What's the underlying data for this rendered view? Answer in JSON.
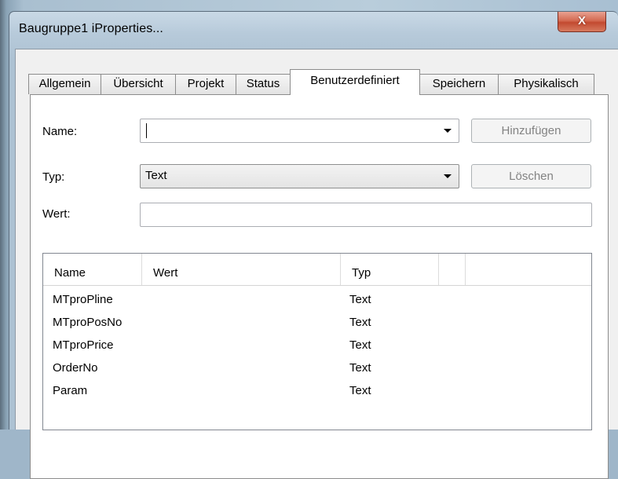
{
  "window": {
    "title": "Baugruppe1 iProperties...",
    "close_glyph": "X"
  },
  "tabs": [
    {
      "label": "Allgemein"
    },
    {
      "label": "Übersicht"
    },
    {
      "label": "Projekt"
    },
    {
      "label": "Status"
    },
    {
      "label": "Benutzerdefiniert",
      "active": true
    },
    {
      "label": "Speichern"
    },
    {
      "label": "Physikalisch"
    }
  ],
  "form": {
    "name_label": "Name:",
    "name_value": "",
    "type_label": "Typ:",
    "type_value": "Text",
    "value_label": "Wert:",
    "value_value": "",
    "add_button": "Hinzufügen",
    "delete_button": "Löschen"
  },
  "table": {
    "columns": [
      "Name",
      "Wert",
      "Typ"
    ],
    "rows": [
      {
        "name": "MTproPline",
        "value": "",
        "type": "Text"
      },
      {
        "name": "MTproPosNo",
        "value": "",
        "type": "Text"
      },
      {
        "name": "MTproPrice",
        "value": "",
        "type": "Text"
      },
      {
        "name": "OrderNo",
        "value": "",
        "type": "Text"
      },
      {
        "name": "Param",
        "value": "",
        "type": "Text"
      }
    ]
  },
  "colors": {
    "close_button": "#c9533a",
    "disabled_text": "#838383"
  }
}
